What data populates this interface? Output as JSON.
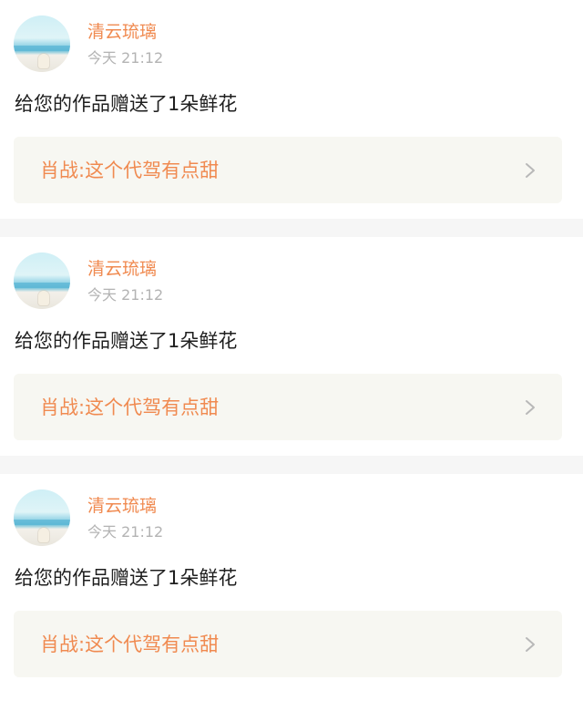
{
  "notifications": [
    {
      "username": "清云琉璃",
      "timestamp": "今天 21:12",
      "message": "给您的作品赠送了1朵鲜花",
      "work_link": "肖战:这个代驾有点甜"
    },
    {
      "username": "清云琉璃",
      "timestamp": "今天 21:12",
      "message": "给您的作品赠送了1朵鲜花",
      "work_link": "肖战:这个代驾有点甜"
    },
    {
      "username": "清云琉璃",
      "timestamp": "今天 21:12",
      "message": "给您的作品赠送了1朵鲜花",
      "work_link": "肖战:这个代驾有点甜"
    }
  ],
  "icons": {
    "link_arrow": "chevron-right-icon",
    "avatar": "beach-avatar"
  },
  "colors": {
    "accent": "#f08a50",
    "timestamp": "#b3b3b3",
    "link_box_bg": "#f7f7f2",
    "separator": "#f6f6f6"
  }
}
